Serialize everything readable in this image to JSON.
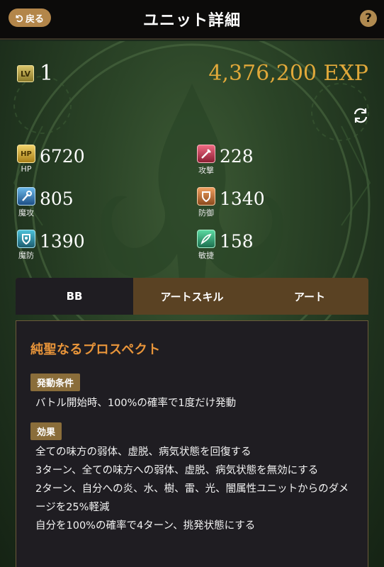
{
  "header": {
    "back_label": "戻る",
    "title": "ユニット詳細",
    "help_label": "?"
  },
  "level": {
    "badge": "LV",
    "value": "1",
    "exp": "4,376,200 EXP"
  },
  "stats": {
    "hp": {
      "badge": "HP",
      "label": "HP",
      "value": "6720"
    },
    "atk": {
      "label": "攻撃",
      "value": "228"
    },
    "matk": {
      "label": "魔攻",
      "value": "805"
    },
    "def": {
      "label": "防御",
      "value": "1340"
    },
    "mdef": {
      "label": "魔防",
      "value": "1390"
    },
    "spd": {
      "label": "敏捷",
      "value": "158"
    }
  },
  "tabs": [
    {
      "label": "BB",
      "active": true
    },
    {
      "label": "アートスキル",
      "active": false
    },
    {
      "label": "アート",
      "active": false
    }
  ],
  "skill": {
    "name": "純聖なるプロスペクト",
    "condition_tag": "発動条件",
    "condition": "バトル開始時、100%の確率で1度だけ発動",
    "effect_tag": "効果",
    "effects": [
      "全ての味方の弱体、虚脱、病気状態を回復する",
      "3ターン、全ての味方への弱体、虚脱、病気状態を無効にする",
      "2ターン、自分への炎、水、樹、雷、光、闇属性ユニットからのダメ",
      "ージを25%軽減",
      "自分を100%の確率で4ターン、挑発状態にする"
    ]
  },
  "colors": {
    "accent_gold": "#e0a83a",
    "skill_title": "#e9953a",
    "tab_bg": "#5a4223",
    "panel_bg": "#1f1d22",
    "tag_bg": "#8a6d3a"
  }
}
